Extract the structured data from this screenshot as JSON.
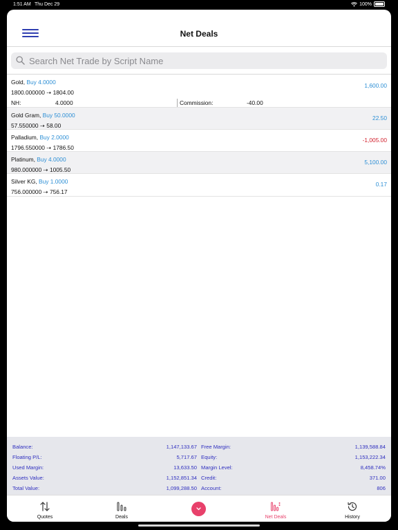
{
  "status": {
    "time": "1:51 AM",
    "date": "Thu Dec 29",
    "battery": "100%"
  },
  "nav": {
    "title": "Net Deals"
  },
  "search": {
    "placeholder": "Search Net Trade by Script Name"
  },
  "deals": [
    {
      "symbol": "Gold,",
      "side": "Buy 4.0000",
      "from": "1800.000000",
      "arrow": "⇢",
      "to": "1804.00",
      "pl": "1,600.00",
      "pl_sign": "pos",
      "nh_label": "NH:",
      "nh_value": "4.0000",
      "commission_label": "Commission:",
      "commission_value": "-40.00"
    },
    {
      "symbol": "Gold Gram,",
      "side": "Buy 50.0000",
      "from": "57.550000",
      "arrow": "⇢",
      "to": "58.00",
      "pl": "22.50",
      "pl_sign": "pos"
    },
    {
      "symbol": "Palladium,",
      "side": "Buy 2.0000",
      "from": "1796.550000",
      "arrow": "⇢",
      "to": "1786.50",
      "pl": "-1,005.00",
      "pl_sign": "neg"
    },
    {
      "symbol": "Platinum,",
      "side": "Buy 4.0000",
      "from": "980.000000",
      "arrow": "⇢",
      "to": "1005.50",
      "pl": "5,100.00",
      "pl_sign": "pos"
    },
    {
      "symbol": "Silver KG,",
      "side": "Buy 1.0000",
      "from": "756.000000",
      "arrow": "⇢",
      "to": "756.17",
      "pl": "0.17",
      "pl_sign": "pos"
    }
  ],
  "summary": [
    {
      "l1": "Balance:",
      "v1": "1,147,133.67",
      "l2": "Free Margin:",
      "v2": "1,139,588.84"
    },
    {
      "l1": "Floating P/L:",
      "v1": "5,717.67",
      "l2": "Equity:",
      "v2": "1,153,222.34"
    },
    {
      "l1": "Used Margin:",
      "v1": "13,633.50",
      "l2": "Margin Level:",
      "v2": "8,458.74%"
    },
    {
      "l1": "Assets Value:",
      "v1": "1,152,851.34",
      "l2": "Credit:",
      "v2": "371.00"
    },
    {
      "l1": "Total Value:",
      "v1": "1,099,288.50",
      "l2": "Account:",
      "v2": "806"
    }
  ],
  "tabs": [
    {
      "label": "Quotes",
      "icon": "quotes-arrows-icon"
    },
    {
      "label": "Deals",
      "icon": "deals-bars-icon"
    },
    {
      "label": "Net Deals",
      "icon": "net-deals-icon",
      "active": true
    },
    {
      "label": "History",
      "icon": "history-clock-icon"
    }
  ],
  "colors": {
    "accent": "#2d8fd5",
    "negative": "#d21f2c",
    "summary_text": "#2f2fbf",
    "tab_active": "#e8416b",
    "menu": "#2e3db0"
  }
}
